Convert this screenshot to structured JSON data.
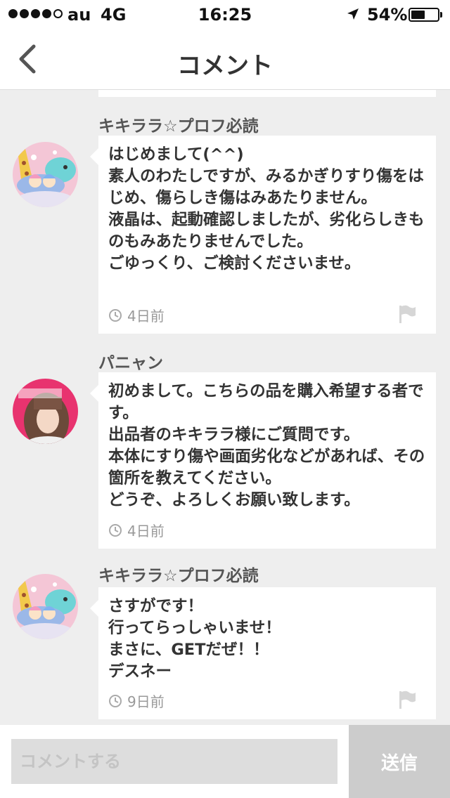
{
  "status_bar": {
    "carrier": "au",
    "network": "4G",
    "time": "16:25",
    "battery_percent": "54%",
    "battery_level": 0.54,
    "signal_bars_filled": 4,
    "signal_bars_total": 5,
    "icons": [
      "location-arrow-icon"
    ]
  },
  "nav": {
    "title": "コメント",
    "back_icon": "chevron-left-icon"
  },
  "comments": [
    {
      "username": "キキララ☆プロフ必読",
      "text": "はじめまして(^^)\n素人のわたしですが、みるかぎりすり傷をはじめ、傷らしき傷はみあたりません。\n液晶は、起動確認しましたが、劣化らしきものもみあたりませんでした。\nごゆっくり、ご検討くださいませ。",
      "time": "4日前",
      "avatar": "little-twin-stars-avatar"
    },
    {
      "username": "パニャン",
      "text": "初めまして。こちらの品を購入希望する者です。\n出品者のキキララ様にご質問です。\n本体にすり傷や画面劣化などがあれば、その箇所を教えてください。\nどうぞ、よろしくお願い致します。",
      "time": "4日前",
      "avatar": "photo-avatar"
    },
    {
      "username": "キキララ☆プロフ必読",
      "text": "さすがです！\n行ってらっしゃいませ！\nまさに、GETだぜ！！\nデスネー",
      "time": "9日前",
      "avatar": "little-twin-stars-avatar"
    }
  ],
  "input": {
    "placeholder": "コメントする",
    "value": ""
  },
  "send_button": {
    "label": "送信"
  },
  "colors": {
    "list_background": "#eeeeee",
    "bubble": "#ffffff",
    "text": "#333333",
    "muted": "#999999",
    "send_button_bg": "#cccccc"
  }
}
